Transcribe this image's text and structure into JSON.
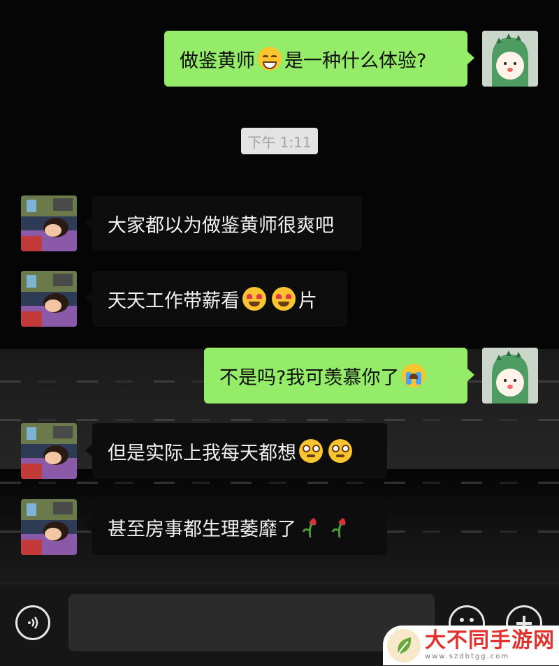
{
  "messages": [
    {
      "side": "me",
      "parts": [
        "做鉴黄师",
        "emoji:grin",
        "是一种什么体验?"
      ]
    },
    {
      "side": "them",
      "text": "大家都以为做鉴黄师很爽吧"
    },
    {
      "side": "them",
      "parts": [
        "天天工作带薪看",
        "emoji:heart-eyes",
        "emoji:heart-eyes",
        "片"
      ]
    },
    {
      "side": "me",
      "parts": [
        "不是吗?我可羡慕你了",
        "emoji:crying"
      ]
    },
    {
      "side": "them",
      "parts": [
        "但是实际上我每天都想",
        "emoji:drooling",
        "emoji:drooling"
      ]
    },
    {
      "side": "them",
      "parts": [
        "甚至房事都生理萎靡了",
        "emoji:wilted-rose",
        "emoji:wilted-rose"
      ]
    }
  ],
  "timestamp": "下午 1:11",
  "bubbles": {
    "m1_a": "做鉴黄师",
    "m1_b": "是一种什么体验?",
    "m2": "大家都以为做鉴黄师很爽吧",
    "m3_a": "天天工作带薪看",
    "m3_b": "片",
    "m4": "不是吗?我可羡慕你了",
    "m5": "但是实际上我每天都想",
    "m6": "甚至房事都生理萎靡了"
  },
  "input": {
    "placeholder": ""
  },
  "watermark": {
    "title": "大不同手游网",
    "url": "www.szdbtgg.com"
  },
  "colors": {
    "me_bubble": "#95ec69",
    "them_bubble": "#0d0d0d",
    "background": "#050505",
    "watermark_red": "#e0312b"
  },
  "icons": {
    "voice": "voice-icon",
    "emoji": "smiley-icon",
    "plus": "plus-icon"
  }
}
